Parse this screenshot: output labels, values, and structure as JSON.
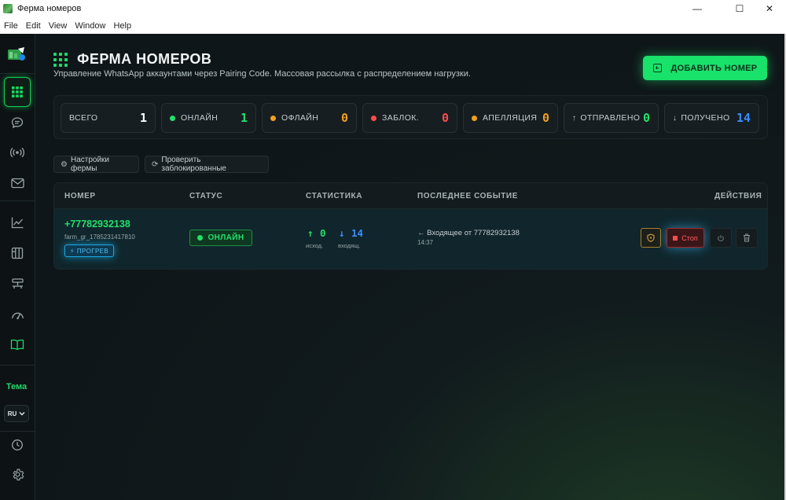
{
  "window": {
    "title": "Ферма номеров",
    "menu": [
      "File",
      "Edit",
      "View",
      "Window",
      "Help"
    ]
  },
  "sidebar": {
    "theme_label": "Тема",
    "language": "RU"
  },
  "header": {
    "title": "ФЕРМА НОМЕРОВ",
    "subtitle": "Управление WhatsApp аккаунтами через Pairing Code. Массовая рассылка с распределением нагрузки.",
    "add_button": "ДОБАВИТЬ НОМЕР"
  },
  "stats": [
    {
      "label": "ВСЕГО",
      "value": "1",
      "color": "#ffffff"
    },
    {
      "label": "ОНЛАЙН",
      "value": "1",
      "dot": "#22e06a",
      "color": "#22e06a"
    },
    {
      "label": "ОФЛАЙН",
      "value": "0",
      "dot": "#f0a020",
      "color": "#f0a020"
    },
    {
      "label": "ЗАБЛОК.",
      "value": "0",
      "dot": "#ff4d4d",
      "color": "#ff4d4d"
    },
    {
      "label": "АПЕЛЛЯЦИЯ",
      "value": "0",
      "dot": "#f0a020",
      "color": "#f0a020"
    },
    {
      "label": "ОТПРАВЛЕНО",
      "value": "0",
      "arrow": "↑",
      "color": "#22e06a"
    },
    {
      "label": "ПОЛУЧЕНО",
      "value": "14",
      "arrow": "↓",
      "color": "#3c8cff"
    }
  ],
  "toolbar": {
    "farm_settings": "Настройки фермы",
    "check_blocked": "Проверить заблокированные"
  },
  "table": {
    "headers": {
      "number": "НОМЕР",
      "status": "СТАТУС",
      "stats": "СТАТИСТИКА",
      "last_event": "ПОСЛЕДНЕЕ СОБЫТИЕ",
      "actions": "ДЕЙСТВИЯ"
    },
    "rows": [
      {
        "phone": "+77782932138",
        "session": "farm_gr_1785231417810",
        "badge": "ПРОГРЕВ",
        "status": "ОНЛАЙН",
        "sent": "0",
        "sent_label": "исход.",
        "received": "14",
        "received_label": "входящ.",
        "event": "← Входящее от 77782932138",
        "event_time": "14:37",
        "stop_label": "Стоп"
      }
    ]
  },
  "colors": {
    "accent": "#22e06a",
    "incoming": "#3c8cff",
    "warning": "#f0a020",
    "danger": "#ff4d4d"
  }
}
